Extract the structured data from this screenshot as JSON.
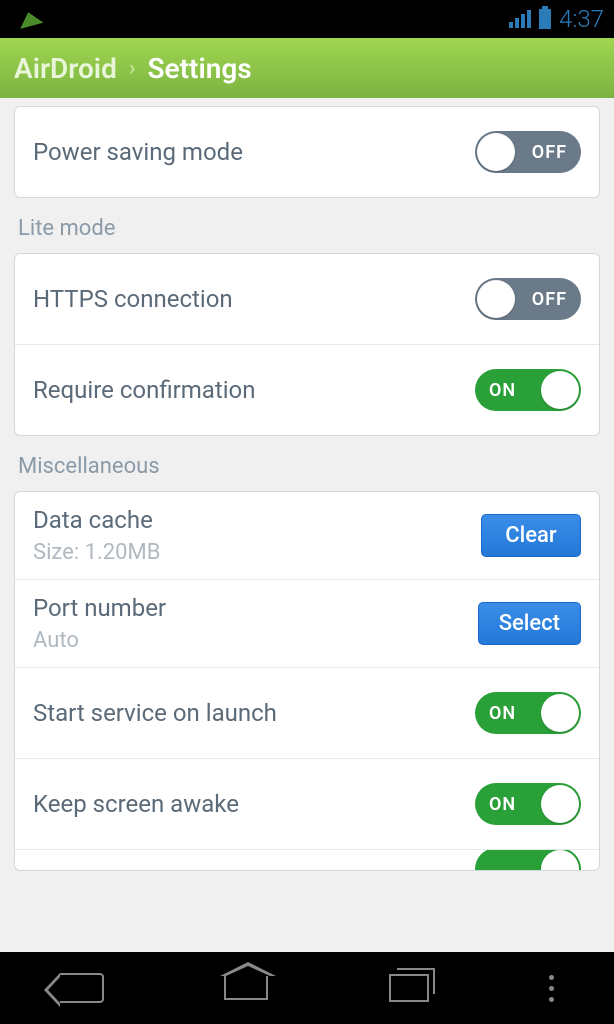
{
  "status": {
    "time": "4:37"
  },
  "header": {
    "app": "AirDroid",
    "title": "Settings"
  },
  "top_card": {
    "power_saving": {
      "label": "Power saving mode",
      "state": "OFF"
    }
  },
  "lite_section": {
    "header": "Lite mode",
    "https": {
      "label": "HTTPS connection",
      "state": "OFF"
    },
    "require_confirm": {
      "label": "Require confirmation",
      "state": "ON"
    }
  },
  "misc_section": {
    "header": "Miscellaneous",
    "data_cache": {
      "label": "Data cache",
      "sub": "Size: 1.20MB",
      "button": "Clear"
    },
    "port": {
      "label": "Port number",
      "sub": "Auto",
      "button": "Select"
    },
    "start_service": {
      "label": "Start service on launch",
      "state": "ON"
    },
    "keep_awake": {
      "label": "Keep screen awake",
      "state": "ON"
    }
  }
}
